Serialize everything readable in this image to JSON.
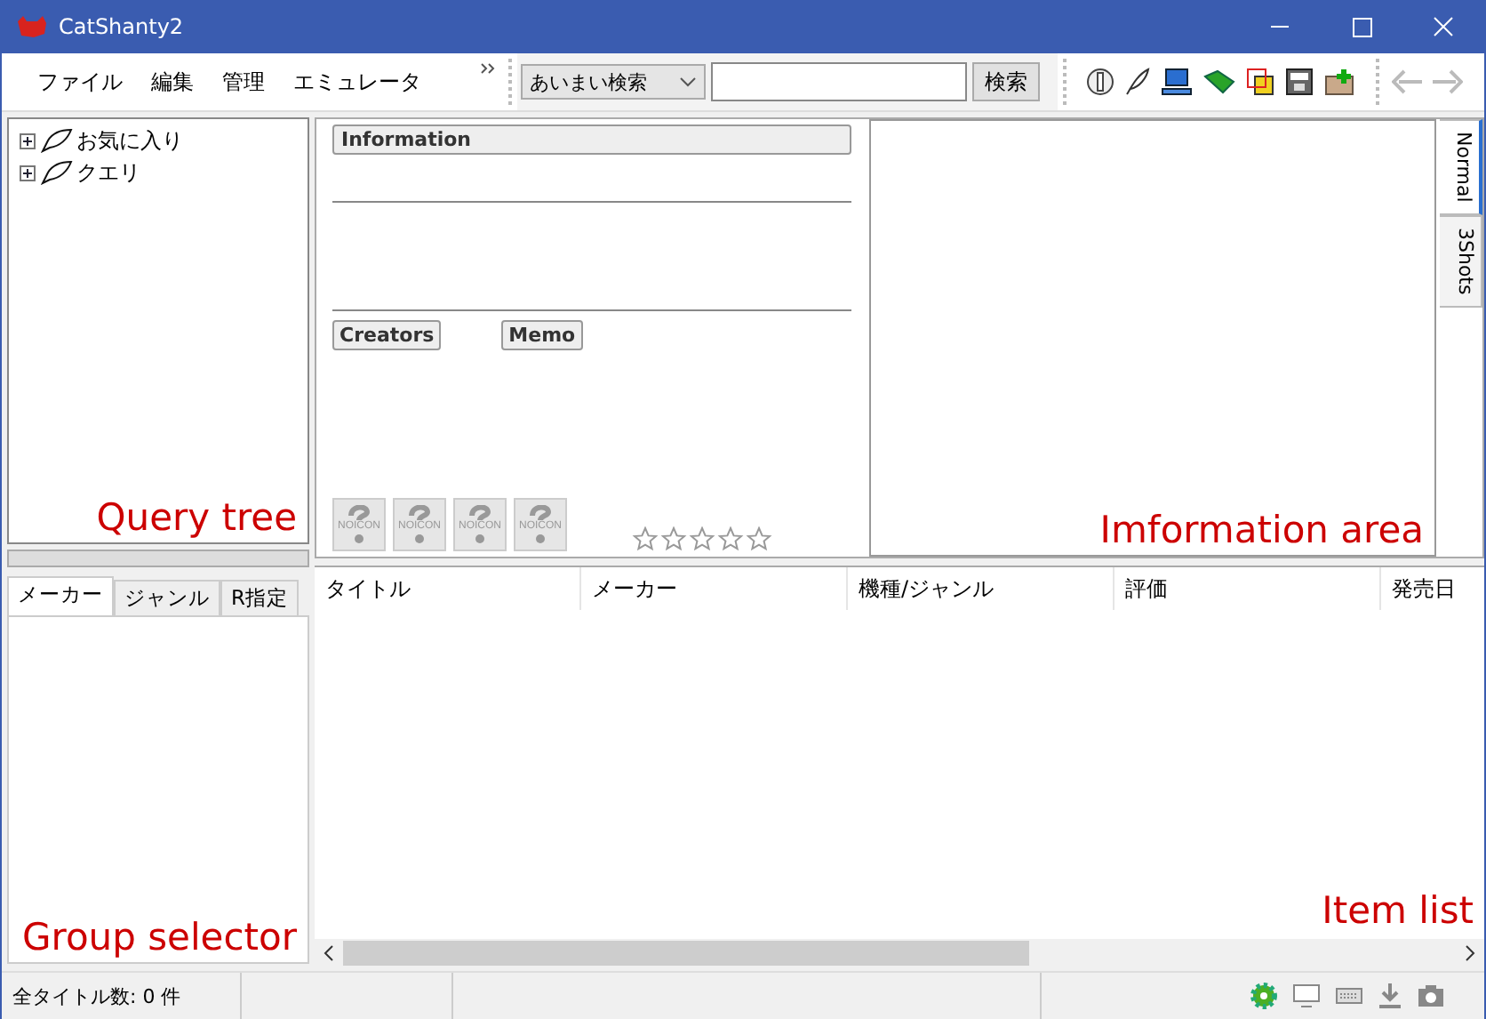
{
  "window": {
    "title": "CatShanty2"
  },
  "menu": [
    "ファイル",
    "編集",
    "管理",
    "エミュレータ"
  ],
  "search": {
    "mode": "あいまい検索",
    "button": "検索"
  },
  "query_tree": [
    {
      "label": "お気に入り",
      "expanded": false
    },
    {
      "label": "クエリ",
      "expanded": false
    }
  ],
  "group_tabs": [
    {
      "label": "メーカー",
      "selected": true
    },
    {
      "label": "ジャンル",
      "selected": false
    },
    {
      "label": "R指定",
      "selected": false
    }
  ],
  "info": {
    "header": "Information",
    "buttons": [
      "Creators",
      "Memo"
    ],
    "no_icons": [
      "NOICON",
      "NOICON",
      "NOICON",
      "NOICON"
    ],
    "stars": 0
  },
  "side_tabs": [
    {
      "label": "Normal",
      "selected": true
    },
    {
      "label": "3Shots",
      "selected": false
    }
  ],
  "list": {
    "columns": [
      "タイトル",
      "メーカー",
      "機種/ジャンル",
      "評価",
      "発売日"
    ]
  },
  "status_bar": {
    "count": "全タイトル数: 0 件"
  },
  "annotations": {
    "query_tree": "Query tree",
    "information_area": "Imformation area",
    "group_selector": "Group selector",
    "item_list": "Item list"
  }
}
